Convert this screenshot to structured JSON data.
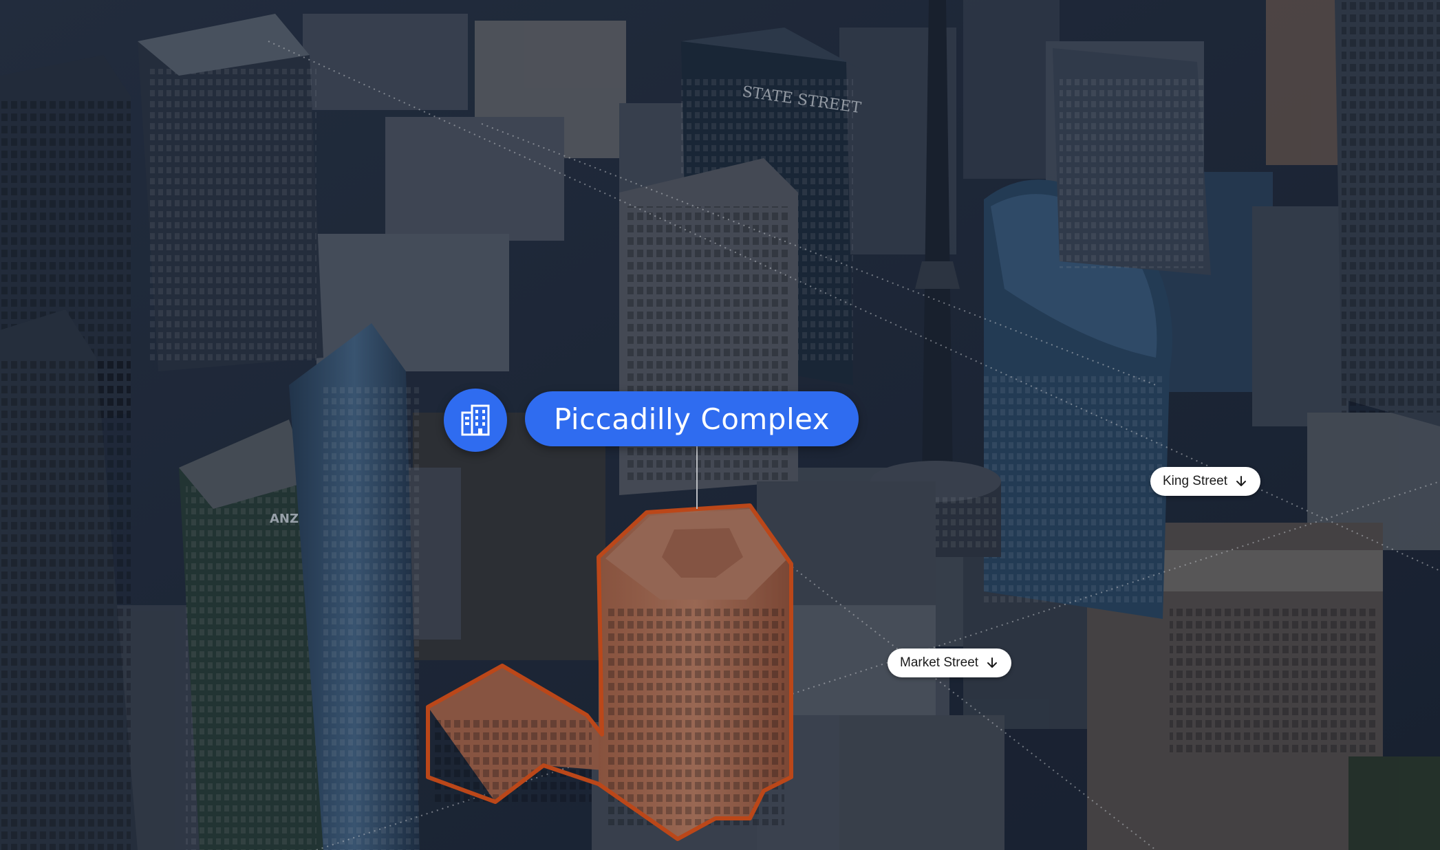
{
  "highlight": {
    "name": "Piccadilly Complex",
    "icon": "building-icon",
    "accent_color": "#2f6cf0",
    "outline_color": "#ff5a14"
  },
  "streets": {
    "king": {
      "label": "King Street",
      "icon": "arrow-down-icon"
    },
    "market": {
      "label": "Market Street",
      "icon": "arrow-down-icon"
    }
  },
  "photo": {
    "sign_text": "STATE STREET",
    "logo_text": "ANZ"
  }
}
